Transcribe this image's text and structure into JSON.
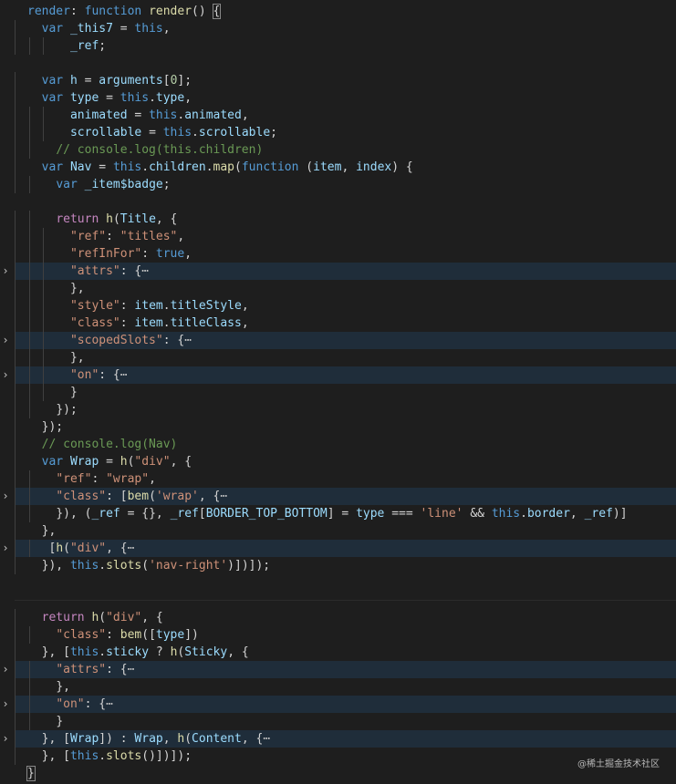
{
  "watermark": "@稀土掘金技术社区",
  "lines": [
    {
      "folded": false,
      "tokens": [
        [
          "kw",
          "render"
        ],
        [
          "punct",
          ": "
        ],
        [
          "kw",
          "function"
        ],
        [
          "plain",
          " "
        ],
        [
          "fn",
          "render"
        ],
        [
          "punct",
          "() "
        ],
        [
          "bracket",
          "{"
        ]
      ]
    },
    {
      "folded": false,
      "tokens": [
        [
          "plain",
          "  "
        ],
        [
          "kw",
          "var"
        ],
        [
          "plain",
          " "
        ],
        [
          "var",
          "_this7"
        ],
        [
          "plain",
          " = "
        ],
        [
          "kw",
          "this"
        ],
        [
          "punct",
          ","
        ]
      ]
    },
    {
      "folded": false,
      "tokens": [
        [
          "plain",
          "      "
        ],
        [
          "var",
          "_ref"
        ],
        [
          "punct",
          ";"
        ]
      ]
    },
    {
      "folded": false,
      "tokens": []
    },
    {
      "folded": false,
      "tokens": [
        [
          "plain",
          "  "
        ],
        [
          "kw",
          "var"
        ],
        [
          "plain",
          " "
        ],
        [
          "var",
          "h"
        ],
        [
          "plain",
          " = "
        ],
        [
          "var",
          "arguments"
        ],
        [
          "punct",
          "["
        ],
        [
          "num",
          "0"
        ],
        [
          "punct",
          "];"
        ]
      ]
    },
    {
      "folded": false,
      "tokens": [
        [
          "plain",
          "  "
        ],
        [
          "kw",
          "var"
        ],
        [
          "plain",
          " "
        ],
        [
          "var",
          "type"
        ],
        [
          "plain",
          " = "
        ],
        [
          "kw",
          "this"
        ],
        [
          "punct",
          "."
        ],
        [
          "var",
          "type"
        ],
        [
          "punct",
          ","
        ]
      ]
    },
    {
      "folded": false,
      "tokens": [
        [
          "plain",
          "      "
        ],
        [
          "var",
          "animated"
        ],
        [
          "plain",
          " = "
        ],
        [
          "kw",
          "this"
        ],
        [
          "punct",
          "."
        ],
        [
          "var",
          "animated"
        ],
        [
          "punct",
          ","
        ]
      ]
    },
    {
      "folded": false,
      "tokens": [
        [
          "plain",
          "      "
        ],
        [
          "var",
          "scrollable"
        ],
        [
          "plain",
          " = "
        ],
        [
          "kw",
          "this"
        ],
        [
          "punct",
          "."
        ],
        [
          "var",
          "scrollable"
        ],
        [
          "punct",
          ";"
        ]
      ]
    },
    {
      "folded": false,
      "tokens": [
        [
          "plain",
          "    "
        ],
        [
          "cmt",
          "// console.log(this.children)"
        ]
      ]
    },
    {
      "folded": false,
      "tokens": [
        [
          "plain",
          "  "
        ],
        [
          "kw",
          "var"
        ],
        [
          "plain",
          " "
        ],
        [
          "var",
          "Nav"
        ],
        [
          "plain",
          " = "
        ],
        [
          "kw",
          "this"
        ],
        [
          "punct",
          "."
        ],
        [
          "var",
          "children"
        ],
        [
          "punct",
          "."
        ],
        [
          "fn",
          "map"
        ],
        [
          "punct",
          "("
        ],
        [
          "kw",
          "function"
        ],
        [
          "plain",
          " ("
        ],
        [
          "var",
          "item"
        ],
        [
          "punct",
          ", "
        ],
        [
          "var",
          "index"
        ],
        [
          "punct",
          ") {"
        ]
      ]
    },
    {
      "folded": false,
      "tokens": [
        [
          "plain",
          "    "
        ],
        [
          "kw",
          "var"
        ],
        [
          "plain",
          " "
        ],
        [
          "var",
          "_item$badge"
        ],
        [
          "punct",
          ";"
        ]
      ]
    },
    {
      "folded": false,
      "tokens": []
    },
    {
      "folded": false,
      "tokens": [
        [
          "plain",
          "    "
        ],
        [
          "ctrl",
          "return"
        ],
        [
          "plain",
          " "
        ],
        [
          "fn",
          "h"
        ],
        [
          "punct",
          "("
        ],
        [
          "var",
          "Title"
        ],
        [
          "punct",
          ", {"
        ]
      ]
    },
    {
      "folded": false,
      "tokens": [
        [
          "plain",
          "      "
        ],
        [
          "str",
          "\"ref\""
        ],
        [
          "punct",
          ": "
        ],
        [
          "str",
          "\"titles\""
        ],
        [
          "punct",
          ","
        ]
      ]
    },
    {
      "folded": false,
      "tokens": [
        [
          "plain",
          "      "
        ],
        [
          "str",
          "\"refInFor\""
        ],
        [
          "punct",
          ": "
        ],
        [
          "kw",
          "true"
        ],
        [
          "punct",
          ","
        ]
      ]
    },
    {
      "folded": true,
      "tokens": [
        [
          "plain",
          "      "
        ],
        [
          "str",
          "\"attrs\""
        ],
        [
          "punct",
          ": {"
        ],
        [
          "ellipsis",
          "⋯"
        ]
      ]
    },
    {
      "folded": false,
      "tokens": [
        [
          "plain",
          "      "
        ],
        [
          "punct",
          "},"
        ]
      ]
    },
    {
      "folded": false,
      "tokens": [
        [
          "plain",
          "      "
        ],
        [
          "str",
          "\"style\""
        ],
        [
          "punct",
          ": "
        ],
        [
          "var",
          "item"
        ],
        [
          "punct",
          "."
        ],
        [
          "var",
          "titleStyle"
        ],
        [
          "punct",
          ","
        ]
      ]
    },
    {
      "folded": false,
      "tokens": [
        [
          "plain",
          "      "
        ],
        [
          "str",
          "\"class\""
        ],
        [
          "punct",
          ": "
        ],
        [
          "var",
          "item"
        ],
        [
          "punct",
          "."
        ],
        [
          "var",
          "titleClass"
        ],
        [
          "punct",
          ","
        ]
      ]
    },
    {
      "folded": true,
      "tokens": [
        [
          "plain",
          "      "
        ],
        [
          "str",
          "\"scopedSlots\""
        ],
        [
          "punct",
          ": {"
        ],
        [
          "ellipsis",
          "⋯"
        ]
      ]
    },
    {
      "folded": false,
      "tokens": [
        [
          "plain",
          "      "
        ],
        [
          "punct",
          "},"
        ]
      ]
    },
    {
      "folded": true,
      "tokens": [
        [
          "plain",
          "      "
        ],
        [
          "str",
          "\"on\""
        ],
        [
          "punct",
          ": {"
        ],
        [
          "ellipsis",
          "⋯"
        ]
      ]
    },
    {
      "folded": false,
      "tokens": [
        [
          "plain",
          "      "
        ],
        [
          "punct",
          "}"
        ]
      ]
    },
    {
      "folded": false,
      "tokens": [
        [
          "plain",
          "    "
        ],
        [
          "punct",
          "});"
        ]
      ]
    },
    {
      "folded": false,
      "tokens": [
        [
          "plain",
          "  "
        ],
        [
          "punct",
          "});"
        ]
      ]
    },
    {
      "folded": false,
      "tokens": [
        [
          "plain",
          "  "
        ],
        [
          "cmt",
          "// console.log(Nav)"
        ]
      ]
    },
    {
      "folded": false,
      "tokens": [
        [
          "plain",
          "  "
        ],
        [
          "kw",
          "var"
        ],
        [
          "plain",
          " "
        ],
        [
          "var",
          "Wrap"
        ],
        [
          "plain",
          " = "
        ],
        [
          "fn",
          "h"
        ],
        [
          "punct",
          "("
        ],
        [
          "str",
          "\"div\""
        ],
        [
          "punct",
          ", {"
        ]
      ]
    },
    {
      "folded": false,
      "tokens": [
        [
          "plain",
          "    "
        ],
        [
          "str",
          "\"ref\""
        ],
        [
          "punct",
          ": "
        ],
        [
          "str",
          "\"wrap\""
        ],
        [
          "punct",
          ","
        ]
      ]
    },
    {
      "folded": true,
      "tokens": [
        [
          "plain",
          "    "
        ],
        [
          "str",
          "\"class\""
        ],
        [
          "punct",
          ": ["
        ],
        [
          "fn",
          "bem"
        ],
        [
          "punct",
          "("
        ],
        [
          "str",
          "'wrap'"
        ],
        [
          "punct",
          ", {"
        ],
        [
          "ellipsis",
          "⋯"
        ]
      ]
    },
    {
      "folded": false,
      "tokens": [
        [
          "plain",
          "    "
        ],
        [
          "punct",
          "}), ("
        ],
        [
          "var",
          "_ref"
        ],
        [
          "plain",
          " = "
        ],
        [
          "punct",
          "{}, "
        ],
        [
          "var",
          "_ref"
        ],
        [
          "punct",
          "["
        ],
        [
          "var",
          "BORDER_TOP_BOTTOM"
        ],
        [
          "punct",
          "] = "
        ],
        [
          "var",
          "type"
        ],
        [
          "plain",
          " === "
        ],
        [
          "str",
          "'line'"
        ],
        [
          "plain",
          " && "
        ],
        [
          "kw",
          "this"
        ],
        [
          "punct",
          "."
        ],
        [
          "var",
          "border"
        ],
        [
          "punct",
          ", "
        ],
        [
          "var",
          "_ref"
        ],
        [
          "punct",
          ")]"
        ]
      ]
    },
    {
      "folded": false,
      "tokens": [
        [
          "plain",
          "  "
        ],
        [
          "punct",
          "},"
        ]
      ]
    },
    {
      "folded": true,
      "tokens": [
        [
          "plain",
          "   "
        ],
        [
          "punct",
          "["
        ],
        [
          "fn",
          "h"
        ],
        [
          "punct",
          "("
        ],
        [
          "str",
          "\"div\""
        ],
        [
          "punct",
          ", {"
        ],
        [
          "ellipsis",
          "⋯"
        ]
      ]
    },
    {
      "folded": false,
      "tokens": [
        [
          "plain",
          "  "
        ],
        [
          "punct",
          "}), "
        ],
        [
          "kw",
          "this"
        ],
        [
          "punct",
          "."
        ],
        [
          "fn",
          "slots"
        ],
        [
          "punct",
          "("
        ],
        [
          "str",
          "'nav-right'"
        ],
        [
          "punct",
          ")])]);"
        ]
      ]
    },
    {
      "folded": false,
      "tokens": []
    },
    {
      "folded": false,
      "tokens": [],
      "separator": true
    },
    {
      "folded": false,
      "tokens": [
        [
          "plain",
          "  "
        ],
        [
          "ctrl",
          "return"
        ],
        [
          "plain",
          " "
        ],
        [
          "fn",
          "h"
        ],
        [
          "punct",
          "("
        ],
        [
          "str",
          "\"div\""
        ],
        [
          "punct",
          ", {"
        ]
      ]
    },
    {
      "folded": false,
      "tokens": [
        [
          "plain",
          "    "
        ],
        [
          "str",
          "\"class\""
        ],
        [
          "punct",
          ": "
        ],
        [
          "fn",
          "bem"
        ],
        [
          "punct",
          "(["
        ],
        [
          "var",
          "type"
        ],
        [
          "punct",
          "])"
        ]
      ]
    },
    {
      "folded": false,
      "tokens": [
        [
          "plain",
          "  "
        ],
        [
          "punct",
          "}, ["
        ],
        [
          "kw",
          "this"
        ],
        [
          "punct",
          "."
        ],
        [
          "var",
          "sticky"
        ],
        [
          "plain",
          " ? "
        ],
        [
          "fn",
          "h"
        ],
        [
          "punct",
          "("
        ],
        [
          "var",
          "Sticky"
        ],
        [
          "punct",
          ", {"
        ]
      ]
    },
    {
      "folded": true,
      "tokens": [
        [
          "plain",
          "    "
        ],
        [
          "str",
          "\"attrs\""
        ],
        [
          "punct",
          ": {"
        ],
        [
          "ellipsis",
          "⋯"
        ]
      ]
    },
    {
      "folded": false,
      "tokens": [
        [
          "plain",
          "    "
        ],
        [
          "punct",
          "},"
        ]
      ]
    },
    {
      "folded": true,
      "tokens": [
        [
          "plain",
          "    "
        ],
        [
          "str",
          "\"on\""
        ],
        [
          "punct",
          ": {"
        ],
        [
          "ellipsis",
          "⋯"
        ]
      ]
    },
    {
      "folded": false,
      "tokens": [
        [
          "plain",
          "    "
        ],
        [
          "punct",
          "}"
        ]
      ]
    },
    {
      "folded": true,
      "tokens": [
        [
          "plain",
          "  "
        ],
        [
          "punct",
          "}, ["
        ],
        [
          "var",
          "Wrap"
        ],
        [
          "punct",
          "]) : "
        ],
        [
          "var",
          "Wrap"
        ],
        [
          "punct",
          ", "
        ],
        [
          "fn",
          "h"
        ],
        [
          "punct",
          "("
        ],
        [
          "var",
          "Content"
        ],
        [
          "punct",
          ", {"
        ],
        [
          "ellipsis",
          "⋯"
        ]
      ]
    },
    {
      "folded": false,
      "tokens": [
        [
          "plain",
          "  "
        ],
        [
          "punct",
          "}, ["
        ],
        [
          "kw",
          "this"
        ],
        [
          "punct",
          "."
        ],
        [
          "fn",
          "slots"
        ],
        [
          "punct",
          "()])]);"
        ]
      ]
    },
    {
      "folded": false,
      "tokens": [
        [
          "bracket",
          "}"
        ]
      ]
    }
  ]
}
